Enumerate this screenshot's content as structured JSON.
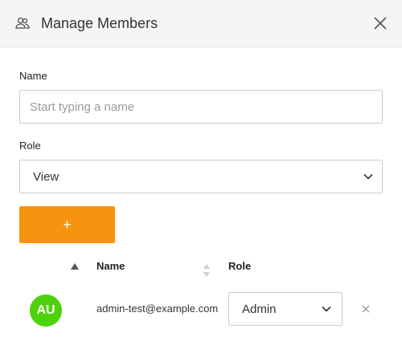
{
  "dialog": {
    "title": "Manage Members",
    "header_icon": "members-icon",
    "close_icon": "close-icon"
  },
  "form": {
    "name_label": "Name",
    "name_placeholder": "Start typing a name",
    "name_value": "",
    "role_label": "Role",
    "role_value": "View",
    "add_button_label": "+"
  },
  "table": {
    "columns": [
      "Name",
      "Role"
    ],
    "sort": {
      "column": "avatar",
      "direction": "ascending"
    },
    "rows": [
      {
        "avatar_initials": "AU",
        "avatar_color": "#4cd10b",
        "email": "admin-test@example.com",
        "role": "Admin"
      }
    ]
  },
  "colors": {
    "accent": "#f7930e",
    "header_bg": "#f5f5f5"
  }
}
